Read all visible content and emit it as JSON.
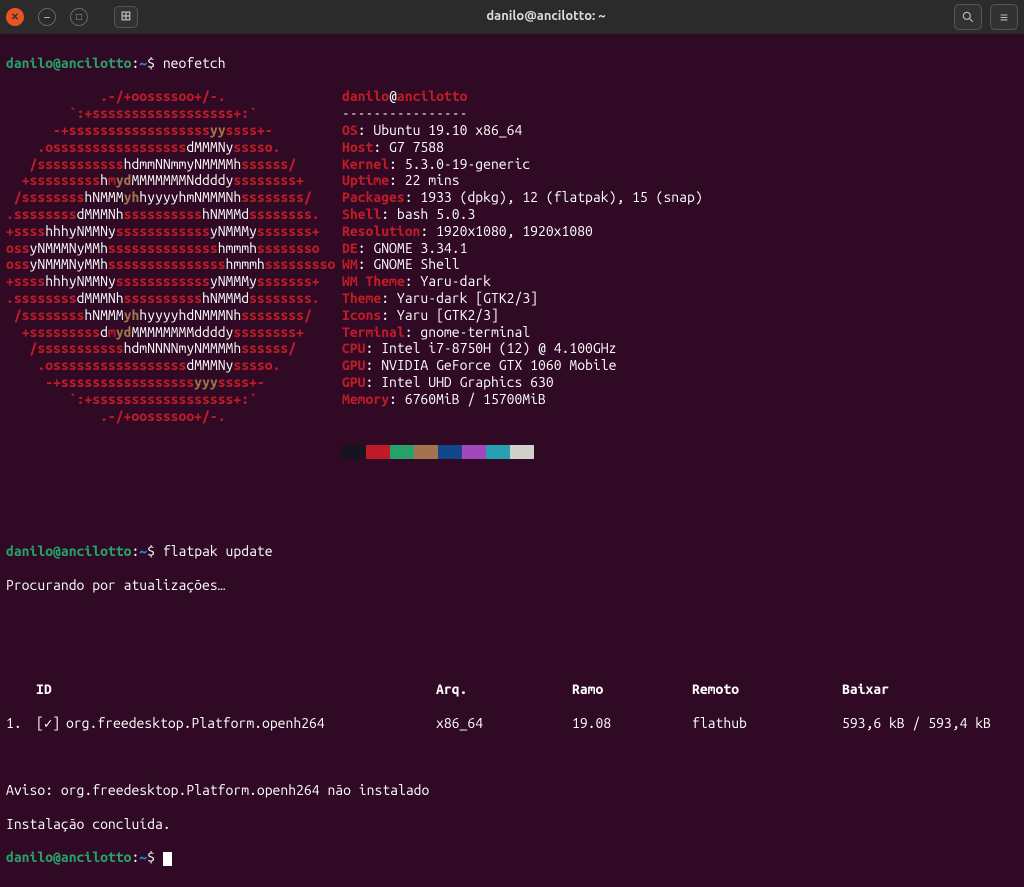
{
  "window": {
    "title": "danilo@ancilotto: ~"
  },
  "prompt": {
    "user_host": "danilo@ancilotto",
    "sep": ":",
    "cwd": "~",
    "dollar": "$"
  },
  "commands": {
    "neofetch": "neofetch",
    "flatpak": "flatpak update"
  },
  "neofetch": {
    "user_at_host": "danilo@ancilotto",
    "divider": "----------------",
    "lines": [
      {
        "k": "OS",
        "v": "Ubuntu 19.10 x86_64"
      },
      {
        "k": "Host",
        "v": "G7 7588"
      },
      {
        "k": "Kernel",
        "v": "5.3.0-19-generic"
      },
      {
        "k": "Uptime",
        "v": "22 mins"
      },
      {
        "k": "Packages",
        "v": "1933 (dpkg), 12 (flatpak), 15 (snap)"
      },
      {
        "k": "Shell",
        "v": "bash 5.0.3"
      },
      {
        "k": "Resolution",
        "v": "1920x1080, 1920x1080"
      },
      {
        "k": "DE",
        "v": "GNOME 3.34.1"
      },
      {
        "k": "WM",
        "v": "GNOME Shell"
      },
      {
        "k": "WM Theme",
        "v": "Yaru-dark"
      },
      {
        "k": "Theme",
        "v": "Yaru-dark [GTK2/3]"
      },
      {
        "k": "Icons",
        "v": "Yaru [GTK2/3]"
      },
      {
        "k": "Terminal",
        "v": "gnome-terminal"
      },
      {
        "k": "CPU",
        "v": "Intel i7-8750H (12) @ 4.100GHz"
      },
      {
        "k": "GPU",
        "v": "NVIDIA GeForce GTX 1060 Mobile"
      },
      {
        "k": "GPU",
        "v": "Intel UHD Graphics 630"
      },
      {
        "k": "Memory",
        "v": "6760MiB / 15700MiB"
      }
    ],
    "colors": [
      "#171421",
      "#c01c28",
      "#26a269",
      "#a2734c",
      "#12488b",
      "#a347ba",
      "#2aa1b3",
      "#d0cfcc"
    ]
  },
  "logo": [
    {
      "pre": "            ",
      "r1": ".-/+oossssoo+/-."
    },
    {
      "pre": "        ",
      "r1": "`:+ssssssssssssssssss+:`"
    },
    {
      "pre": "      ",
      "r1": "-+ssssssssssssssssss",
      "y": "yy",
      "r2": "ssss+-"
    },
    {
      "pre": "    ",
      "r1": ".osssssssssssssssss",
      "w": "dMMMNy",
      "r2": "sssso."
    },
    {
      "pre": "   ",
      "r1": "/sssssssssss",
      "w": "hdmmNNmmyNMMMMh",
      "r2": "ssssss/"
    },
    {
      "pre": "  ",
      "r1": "+sssssssss",
      "w": "h",
      "r0": "m",
      "y": "yd",
      "w2": "MMMMMMMNddddy",
      "r2": "ssssssss+"
    },
    {
      "pre": " ",
      "r1": "/ssssssss",
      "w": "hNMMM",
      "y": "yh",
      "w2": "hyyyyhmNMMMNh",
      "r2": "ssssssss/"
    },
    {
      "pre": "",
      "r1": ".ssssssss",
      "w": "dMMMNh",
      "r0": "ssssssssss",
      "w2": "hNMMMd",
      "r2": "ssssssss."
    },
    {
      "pre": "",
      "r1": "+ssss",
      "w": "hhhyNMMNy",
      "r0": "ssssssssssss",
      "w2": "yNMMMy",
      "r2": "sssssss+"
    },
    {
      "pre": "",
      "r1": "oss",
      "w": "yNMMMNyMMh",
      "r0": "ssssssssssssss",
      "w2": "hmmmh",
      "r2": "ssssssso"
    },
    {
      "pre": "",
      "r1": "oss",
      "w": "yNMMMNyMMh",
      "r0": "sssssssssssssss",
      "w2": "hmmmh",
      "r2": "sssssssso"
    },
    {
      "pre": "",
      "r1": "+ssss",
      "w": "hhhyNMMNy",
      "r0": "ssssssssssss",
      "w2": "yNMMMy",
      "r2": "sssssss+"
    },
    {
      "pre": "",
      "r1": ".ssssssss",
      "w": "dMMMNh",
      "r0": "ssssssssss",
      "w2": "hNMMMd",
      "r2": "ssssssss."
    },
    {
      "pre": " ",
      "r1": "/ssssssss",
      "w": "hNMMM",
      "y": "yh",
      "w2": "hyyyyhdNMMMNh",
      "r2": "ssssssss/"
    },
    {
      "pre": "  ",
      "r1": "+sssssssss",
      "w": "d",
      "r0": "m",
      "y": "yd",
      "w2": "MMMMMMMMddddy",
      "r2": "ssssssss+"
    },
    {
      "pre": "   ",
      "r1": "/sssssssssss",
      "w": "hdmNNNNmyNMMMMh",
      "r2": "ssssss/"
    },
    {
      "pre": "    ",
      "r1": ".osssssssssssssssss",
      "w": "dMMMNy",
      "r2": "sssso."
    },
    {
      "pre": "     ",
      "r1": "-+sssssssssssssssss",
      "y": "yyy",
      "r2": "ssss+-"
    },
    {
      "pre": "        ",
      "r1": "`:+ssssssssssssssssss+:`"
    },
    {
      "pre": "            ",
      "r1": ".-/+oossssoo+/-."
    }
  ],
  "flatpak": {
    "search": "Procurando por atualizações…",
    "hdr": {
      "id": "ID",
      "arq": "Arq.",
      "ramo": "Ramo",
      "remoto": "Remoto",
      "baixar": "Baixar"
    },
    "row1": {
      "num": "1.",
      "check": "[✓]",
      "id": "org.freedesktop.Platform.openh264",
      "arq": "x86_64",
      "ramo": "19.08",
      "remoto": "flathub",
      "baixar": "593,6 kB / 593,4 kB"
    },
    "aviso": "Aviso: org.freedesktop.Platform.openh264 não instalado",
    "done": "Instalação concluída."
  }
}
